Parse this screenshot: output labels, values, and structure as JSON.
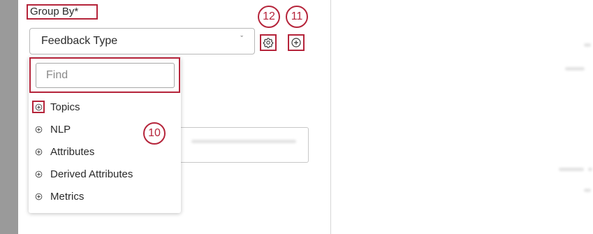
{
  "group_by": {
    "label": "Group By*"
  },
  "select": {
    "value": "Feedback Type",
    "chevron": "ˇ"
  },
  "toolbar": {
    "settings_callout": "12",
    "add_callout": "11",
    "settings_icon": "gear-icon",
    "add_icon": "plus-circle-icon"
  },
  "dropdown": {
    "search_placeholder": "Find",
    "callout": "10",
    "items": [
      {
        "label": "Topics",
        "icon": "plus-circle-icon"
      },
      {
        "label": "NLP",
        "icon": "plus-circle-icon"
      },
      {
        "label": "Attributes",
        "icon": "plus-circle-icon"
      },
      {
        "label": "Derived Attributes",
        "icon": "plus-circle-icon"
      },
      {
        "label": "Metrics",
        "icon": "plus-circle-icon"
      }
    ]
  },
  "colors": {
    "callout": "#b5243a",
    "sidebar": "#9a9a9a"
  }
}
